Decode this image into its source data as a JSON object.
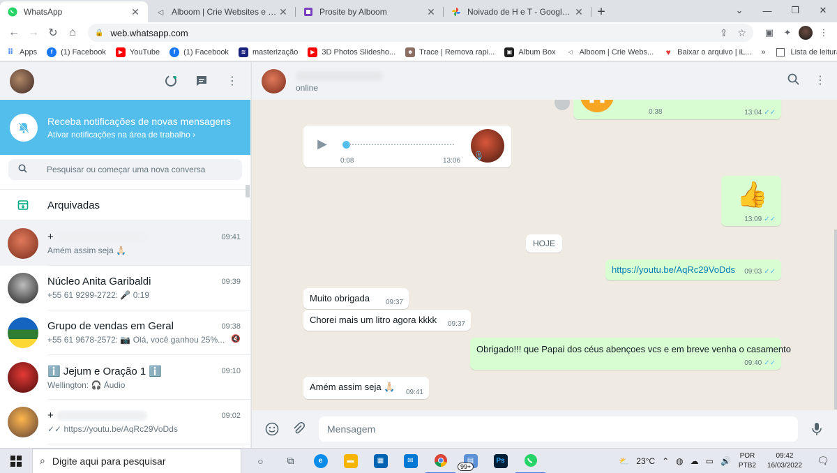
{
  "browser": {
    "tabs": [
      {
        "title": "WhatsApp",
        "icon": "whatsapp-icon",
        "color": "#25d366",
        "active": true
      },
      {
        "title": "Alboom | Crie Websites e tenha s",
        "icon": "alboom-icon",
        "color": "#5f6368"
      },
      {
        "title": "Prosite by Alboom",
        "icon": "prosite-icon",
        "color": "#7b3fbf"
      },
      {
        "title": "Noivado de H e T - Google Fotos",
        "icon": "google-photos-icon",
        "color": "#ea4335"
      }
    ],
    "new_tab": "+",
    "url": "web.whatsapp.com",
    "bookmarks": [
      {
        "label": "Apps",
        "icon": "apps-grid-icon",
        "color": "#4285f4"
      },
      {
        "label": "(1) Facebook",
        "icon": "facebook-icon",
        "color": "#1877f2"
      },
      {
        "label": "YouTube",
        "icon": "youtube-icon",
        "color": "#ff0000"
      },
      {
        "label": "(1) Facebook",
        "icon": "facebook-icon",
        "color": "#1877f2"
      },
      {
        "label": "masterização",
        "icon": "mastering-icon",
        "color": "#1a237e"
      },
      {
        "label": "3D Photos Slidesho...",
        "icon": "youtube-icon",
        "color": "#ff0000"
      },
      {
        "label": "Trace | Remova rapi...",
        "icon": "trace-icon",
        "color": "#8d6e63"
      },
      {
        "label": "Album Box",
        "icon": "album-box-icon",
        "color": "#212121"
      },
      {
        "label": "Alboom | Crie Webs...",
        "icon": "alboom-icon",
        "color": "#5f6368"
      },
      {
        "label": "Baixar o arquivo | iL...",
        "icon": "heart-icon",
        "color": "#e53935"
      }
    ],
    "more": "»",
    "reading_list": "Lista de leitura"
  },
  "sidebar": {
    "notification": {
      "title": "Receba notificações de novas mensagens",
      "subtitle": "Ativar notificações na área de trabalho ›"
    },
    "search_placeholder": "Pesquisar ou começar uma nova conversa",
    "archived_label": "Arquivadas",
    "chats": [
      {
        "name": "+",
        "time": "09:41",
        "message": "Amém assim seja 🙏🏻",
        "avatar_color": "#c0563a",
        "selected": true,
        "blurred_name": true
      },
      {
        "name": "Núcleo Anita Garibaldi",
        "time": "09:39",
        "message": "+55 61 9299-2722: 🎤 0:19",
        "avatar_color": "#3a3a3a"
      },
      {
        "name": "Grupo de vendas em Geral",
        "time": "09:38",
        "message": "+55 61 9678-2572: 📷 Olá, você ganhou 25%...",
        "avatar_color": "#2e7d32",
        "muted": "🔇"
      },
      {
        "name": "ℹ️ Jejum e Oração 1 ℹ️",
        "time": "09:10",
        "message": "Wellington: 🎧 Áudio",
        "avatar_color": "#b71c1c"
      },
      {
        "name": "+",
        "time": "09:02",
        "message": "✓✓ https://youtu.be/AqRc29VoDds",
        "avatar_color": "#8d6e63",
        "blurred_name": true
      }
    ]
  },
  "conversation": {
    "contact_status": "online",
    "messages": {
      "voice_top": {
        "duration": "0:38",
        "time": "13:04",
        "ticks": "✓✓"
      },
      "voice_in": {
        "duration": "0:08",
        "time": "13:06"
      },
      "thumbs": {
        "emoji": "👍",
        "time": "13:09",
        "ticks": "✓✓"
      },
      "day": "HOJE",
      "link": {
        "text": "https://youtu.be/AqRc29VoDds",
        "time": "09:03",
        "ticks": "✓✓"
      },
      "in1": {
        "text": "Muito obrigada",
        "time": "09:37"
      },
      "in2": {
        "text": "Chorei mais um litro agora kkkk",
        "time": "09:37"
      },
      "out1": {
        "text": "Obrigado!!! que Papai dos céus abençoes vcs e em breve venha o casamento",
        "time": "09:40",
        "ticks": "✓✓"
      },
      "in3": {
        "text": "Amém assim seja 🙏🏻",
        "time": "09:41"
      }
    },
    "compose_placeholder": "Mensagem"
  },
  "taskbar": {
    "search_placeholder": "Digite aqui para pesquisar",
    "badge": "99+",
    "temperature": "23°C",
    "lang1": "POR",
    "lang2": "PTB2",
    "time": "09:42",
    "date": "16/03/2022"
  },
  "colors": {
    "whatsapp_green": "#00a884",
    "notification_blue": "#53bdeb",
    "outgoing_bubble": "#d9fdd3",
    "chat_bg": "#efeae2"
  }
}
